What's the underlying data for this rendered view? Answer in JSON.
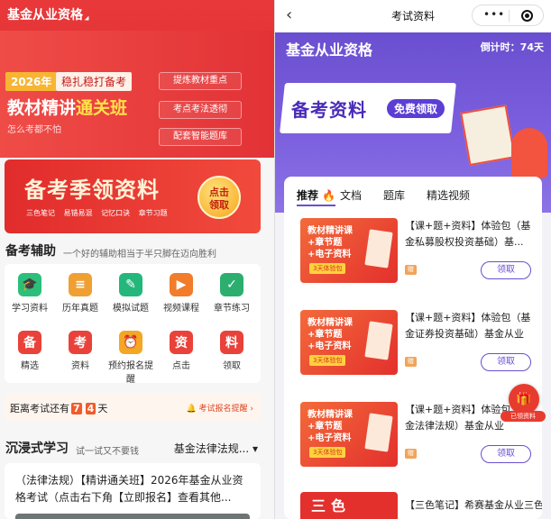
{
  "left": {
    "app_title": "基金从业资格",
    "hero": {
      "year": "2026年",
      "slogan": "稳扎稳打备考",
      "title_main": "教材精讲",
      "title_accent": "通关班",
      "subtitle": "怎么考都不怕",
      "features": [
        "提炼教材重点",
        "考点考法透彻",
        "配套智能题库"
      ]
    },
    "promo": {
      "title": "备考季领资料",
      "tags": [
        "三色笔记",
        "易错易混",
        "记忆口诀",
        "章节习题"
      ],
      "button": "点击\n领取"
    },
    "aids": {
      "title": "备考辅助",
      "subtitle": "一个好的辅助相当于半只脚在迈向胜利",
      "items": [
        {
          "label": "学习资料",
          "icon": "graduation-cap-icon",
          "glyph": "🎓",
          "color": "#2bbf7a"
        },
        {
          "label": "历年真题",
          "icon": "exam-paper-icon",
          "glyph": "≡",
          "color": "#f0a032"
        },
        {
          "label": "模拟试题",
          "icon": "quiz-icon",
          "glyph": "✎",
          "color": "#24b77c"
        },
        {
          "label": "视频课程",
          "icon": "video-camera-icon",
          "glyph": "▶",
          "color": "#f17c2a"
        },
        {
          "label": "章节练习",
          "icon": "checklist-icon",
          "glyph": "✓",
          "color": "#2cae6f"
        },
        {
          "label": "精选",
          "icon": "jing-character-icon",
          "glyph": "备",
          "color": "#e9423a"
        },
        {
          "label": "资料",
          "icon": "kao-character-icon",
          "glyph": "考",
          "color": "#e9423a"
        },
        {
          "label": "预约报名提醒",
          "icon": "alarm-clock-icon",
          "glyph": "⏰",
          "color": "#f5a623"
        },
        {
          "label": "点击",
          "icon": "zi-character-icon",
          "glyph": "资",
          "color": "#e9423a"
        },
        {
          "label": "领取",
          "icon": "liao-character-icon",
          "glyph": "料",
          "color": "#e9423a"
        }
      ]
    },
    "countdown": {
      "prefix": "距离考试还有",
      "digits": [
        "7",
        "4"
      ],
      "suffix": "天",
      "reminder": "考试报名提醒 ›"
    },
    "study": {
      "title": "沉浸式学习",
      "subtitle": "试一试又不要钱",
      "filter": "基金法律法规... ▾",
      "card_text": "（法律法规）【精讲通关班】2026年基金从业资格考试（点击右下角【立即报名】查看其他..."
    }
  },
  "right": {
    "nav": {
      "back": "‹",
      "title": "考试资料",
      "more": "•••"
    },
    "hero": {
      "title": "基金从业资格",
      "countdown": "倒计时：74天",
      "banner": "备考资料",
      "free": "免费领取"
    },
    "tabs": [
      "推荐",
      "文档",
      "题库",
      "精选视频"
    ],
    "items": [
      {
        "name": "【课+题+资料】体验包（基金私募股权投资基础）基...",
        "thumb_lines": [
          "教材精讲课",
          "+章节题",
          "+电子资料"
        ],
        "thumb_badge": "3天体验包",
        "tag": "赠",
        "button": "领取"
      },
      {
        "name": "【课+题+资料】体验包（基金证券投资基础）基金从业",
        "thumb_lines": [
          "教材精讲课",
          "+章节题",
          "+电子资料"
        ],
        "thumb_badge": "3天体验包",
        "tag": "赠",
        "button": "领取"
      },
      {
        "name": "【课+题+资料】体验包（基金法律法规）基金从业",
        "thumb_lines": [
          "教材精讲课",
          "+章节题",
          "+电子资料"
        ],
        "thumb_badge": "3天体验包",
        "tag": "赠",
        "button": "领取"
      }
    ],
    "last_item": {
      "name": "【三色笔记】希赛基金从业三色笔记&",
      "thumb": "三色"
    },
    "float_button": {
      "label": "已领资料"
    }
  }
}
